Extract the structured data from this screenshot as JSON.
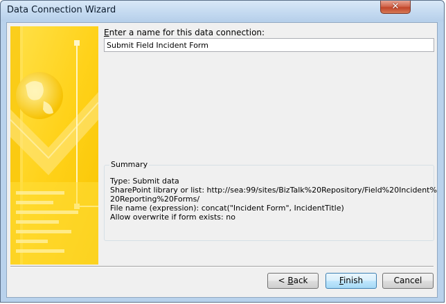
{
  "window": {
    "title": "Data Connection Wizard",
    "close_glyph": "✕"
  },
  "form": {
    "name_prompt": "Enter a name for this data connection:",
    "name_value": "Submit Field Incident Form"
  },
  "summary": {
    "legend": "Summary",
    "lines": [
      "Type: Submit data",
      "SharePoint library or list: http://sea:99/sites/BizTalk%20Repository/Field%20Incident%",
      "20Reporting%20Forms/",
      "File name (expression): concat(\"Incident Form\", IncidentTitle)",
      "Allow overwrite if form exists: no"
    ]
  },
  "buttons": {
    "back_label": "< Back",
    "finish_label": "Finish",
    "cancel_label": "Cancel"
  },
  "colors": {
    "art_primary": "#ffd21a",
    "art_light": "#ffe97a",
    "art_dark": "#f5b800"
  }
}
